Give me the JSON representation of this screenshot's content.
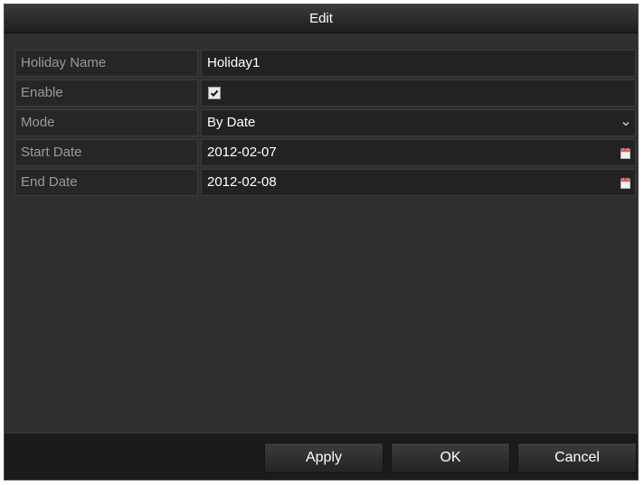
{
  "dialog": {
    "title": "Edit"
  },
  "fields": {
    "holiday_name": {
      "label": "Holiday Name",
      "value": "Holiday1"
    },
    "enable": {
      "label": "Enable",
      "checked": true
    },
    "mode": {
      "label": "Mode",
      "value": "By Date"
    },
    "start_date": {
      "label": "Start Date",
      "value": "2012-02-07"
    },
    "end_date": {
      "label": "End Date",
      "value": "2012-02-08"
    }
  },
  "buttons": {
    "apply": "Apply",
    "ok": "OK",
    "cancel": "Cancel"
  },
  "colors": {
    "background": "#2f2f2f",
    "label_text": "#9a9a9a",
    "value_text": "#ffffff",
    "calendar_icon": "#e85050"
  },
  "icons": {
    "checkbox": "checkmark-icon",
    "mode_dropdown": "chevron-down-icon",
    "start_date_picker": "calendar-icon",
    "end_date_picker": "calendar-icon"
  }
}
